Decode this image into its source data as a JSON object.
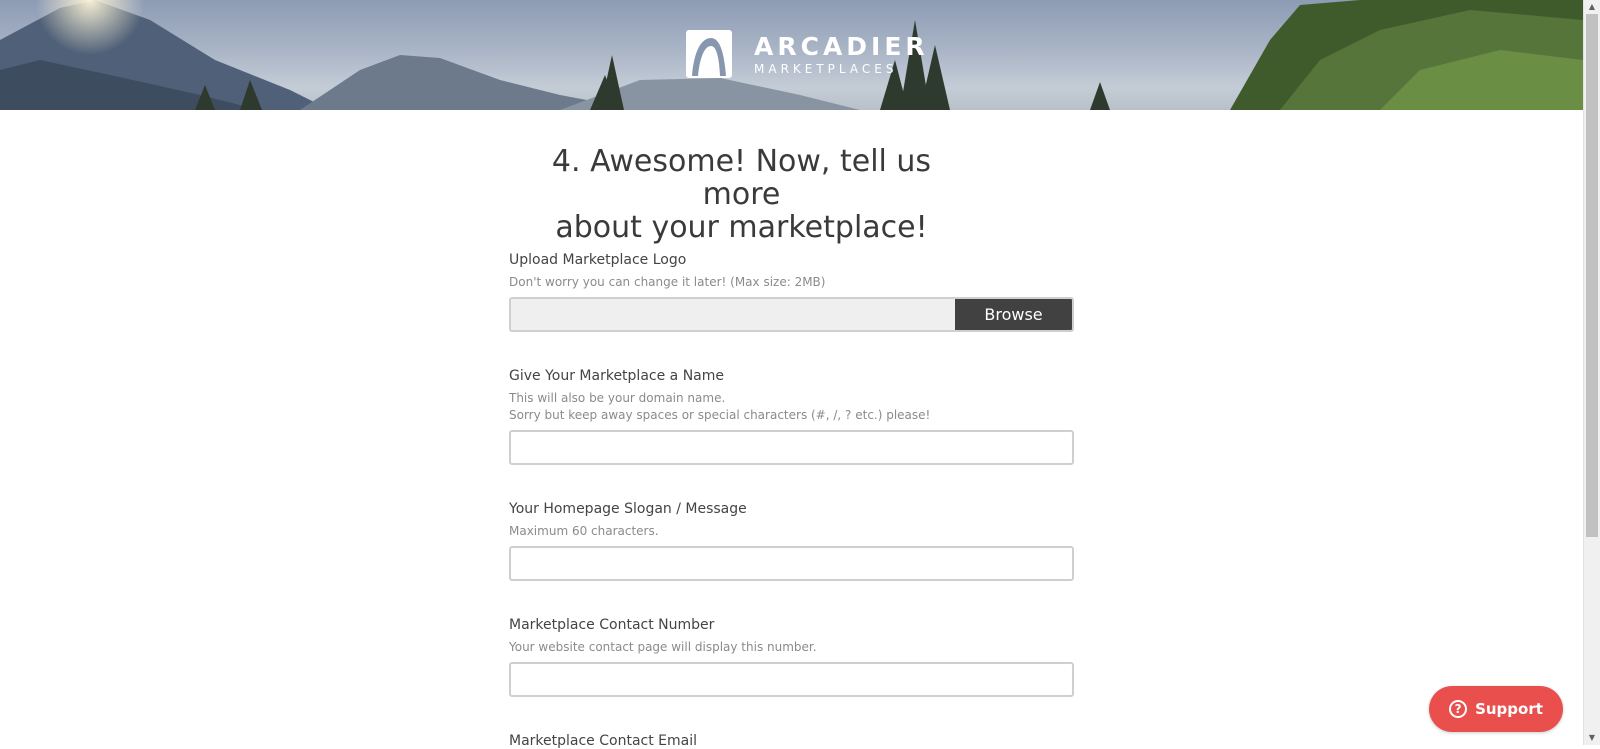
{
  "brand": {
    "name": "ARCADIER",
    "sub": "MARKETPLACES"
  },
  "step": {
    "title_line1": "4. Awesome! Now, tell us more",
    "title_line2": "about your marketplace!"
  },
  "logo_upload": {
    "label": "Upload Marketplace Logo",
    "help": "Don't worry you can change it later! (Max size: 2MB)",
    "browse_label": "Browse"
  },
  "name_field": {
    "label": "Give Your Marketplace a Name",
    "help_line1": "This will also be your domain name.",
    "help_line2": "Sorry but keep away spaces or special characters (#, /, ? etc.) please!",
    "value": ""
  },
  "slogan_field": {
    "label": "Your Homepage Slogan / Message",
    "help": "Maximum 60 characters.",
    "value": ""
  },
  "contact_number_field": {
    "label": "Marketplace Contact Number",
    "help": "Your website contact page will display this number.",
    "value": ""
  },
  "contact_email_field": {
    "label": "Marketplace Contact Email"
  },
  "support": {
    "label": "Support",
    "icon": "?"
  },
  "colors": {
    "accent_support": "#e9504d",
    "browse_button": "#414141"
  }
}
